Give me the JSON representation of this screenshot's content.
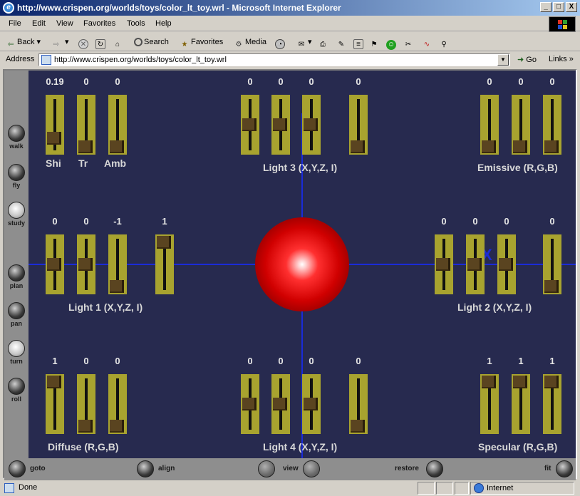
{
  "window": {
    "title": "http://www.crispen.org/worlds/toys/color_lt_toy.wrl - Microsoft Internet Explorer",
    "minimize": "_",
    "maximize": "□",
    "close": "X"
  },
  "menu": [
    "File",
    "Edit",
    "View",
    "Favorites",
    "Tools",
    "Help"
  ],
  "toolbar": {
    "back": "Back",
    "search": "Search",
    "favorites": "Favorites",
    "media": "Media"
  },
  "address": {
    "label": "Address",
    "url": "http://www.crispen.org/worlds/toys/color_lt_toy.wrl",
    "go": "Go",
    "links": "Links"
  },
  "nav_left": [
    {
      "label": "walk",
      "icon": "walk-icon"
    },
    {
      "label": "fly",
      "icon": "fly-icon"
    },
    {
      "label": "study",
      "icon": "study-icon"
    },
    {
      "label": "plan",
      "icon": "plan-icon"
    },
    {
      "label": "pan",
      "icon": "pan-icon"
    },
    {
      "label": "turn",
      "icon": "turn-icon"
    },
    {
      "label": "roll",
      "icon": "roll-icon"
    }
  ],
  "nav_bottom": {
    "goto": "goto",
    "align": "align",
    "view": "view",
    "restore": "restore",
    "fit": "fit"
  },
  "groups": {
    "material": {
      "label": "",
      "sliders": [
        {
          "name": "Shi",
          "value": "0.19",
          "level": 0.19
        },
        {
          "name": "Tr",
          "value": "0",
          "level": 0
        },
        {
          "name": "Amb",
          "value": "0",
          "level": 0
        }
      ]
    },
    "light3": {
      "label": "Light 3 (X,Y,Z, I)",
      "sliders": [
        {
          "value": "0",
          "level": 0.5
        },
        {
          "value": "0",
          "level": 0.5
        },
        {
          "value": "0",
          "level": 0.5
        },
        {
          "value": "0",
          "level": 0
        }
      ]
    },
    "emissive": {
      "label": "Emissive (R,G,B)",
      "sliders": [
        {
          "value": "0",
          "level": 0
        },
        {
          "value": "0",
          "level": 0
        },
        {
          "value": "0",
          "level": 0
        }
      ]
    },
    "light1": {
      "label": "Light 1 (X,Y,Z, I)",
      "sliders": [
        {
          "value": "0",
          "level": 0.5
        },
        {
          "value": "0",
          "level": 0.5
        },
        {
          "value": "-1",
          "level": 0
        },
        {
          "value": "1",
          "level": 1
        }
      ]
    },
    "light2": {
      "label": "Light 2 (X,Y,Z, I)",
      "sliders": [
        {
          "value": "0",
          "level": 0.5
        },
        {
          "value": "0",
          "level": 0.5
        },
        {
          "value": "0",
          "level": 0.5
        },
        {
          "value": "0",
          "level": 0
        }
      ]
    },
    "diffuse": {
      "label": "Diffuse (R,G,B)",
      "sliders": [
        {
          "value": "1",
          "level": 1
        },
        {
          "value": "0",
          "level": 0
        },
        {
          "value": "0",
          "level": 0
        }
      ]
    },
    "light4": {
      "label": "Light 4 (X,Y,Z, I)",
      "sliders": [
        {
          "value": "0",
          "level": 0.5
        },
        {
          "value": "0",
          "level": 0.5
        },
        {
          "value": "0",
          "level": 0.5
        },
        {
          "value": "0",
          "level": 0
        }
      ]
    },
    "specular": {
      "label": "Specular (R,G,B)",
      "sliders": [
        {
          "value": "1",
          "level": 1
        },
        {
          "value": "1",
          "level": 1
        },
        {
          "value": "1",
          "level": 1
        }
      ]
    }
  },
  "axis_labels": {
    "x": "X",
    "y": "Y"
  },
  "status": {
    "text": "Done",
    "zone": "Internet"
  },
  "colors": {
    "scene_bg": "#272a4f",
    "slider": "#a8a32f",
    "knob": "#5a4420",
    "axis": "#1a2bd8",
    "sphere": "#ff2020"
  }
}
